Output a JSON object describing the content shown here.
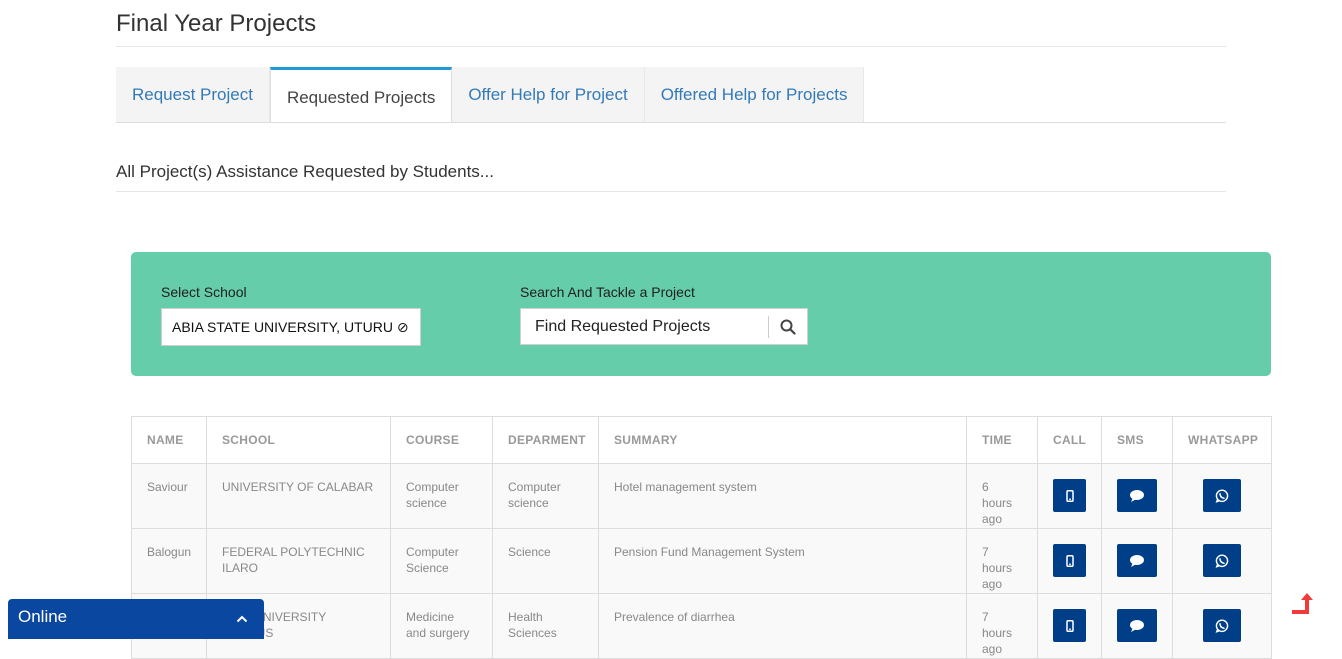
{
  "page": {
    "title": "Final Year Projects"
  },
  "tabs": [
    {
      "label": "Request Project",
      "active": false
    },
    {
      "label": "Requested Projects",
      "active": true
    },
    {
      "label": "Offer Help for Project",
      "active": false
    },
    {
      "label": "Offered Help for Projects",
      "active": false
    }
  ],
  "section": {
    "heading": "All Project(s) Assistance Requested by Students..."
  },
  "filters": {
    "school_label": "Select School",
    "school_value": "ABIA STATE UNIVERSITY, UTURU ⊘",
    "search_label": "Search And Tackle a Project",
    "search_value": "Find Requested Projects",
    "search_icon": "search-icon"
  },
  "table": {
    "headers": [
      "NAME",
      "SCHOOL",
      "COURSE",
      "DEPARMENT",
      "SUMMARY",
      "TIME",
      "CALL",
      "SMS",
      "WHATSAPP"
    ],
    "rows": [
      {
        "name": "Saviour",
        "school": "UNIVERSITY OF CALABAR",
        "course": "Computer science",
        "department": "Computer science",
        "summary": "Hotel management system",
        "time": "6 hours ago"
      },
      {
        "name": "Balogun",
        "school": "FEDERAL POLYTECHNIC ILARO",
        "course": "Computer Science",
        "department": "Science",
        "summary": "Pension Fund Management System",
        "time": "7 hours ago"
      },
      {
        "name": "",
        "school": "TATE UNIVERSITY CAMPUS",
        "course": "Medicine and surgery",
        "department": "Health Sciences",
        "summary": "Prevalence of diarrhea",
        "time": "7 hours ago"
      }
    ],
    "actions": {
      "call_icon": "mobile-phone-icon",
      "sms_icon": "chat-bubble-icon",
      "whatsapp_icon": "whatsapp-icon"
    }
  },
  "chat": {
    "label": "Online",
    "icon": "chevron-up-icon"
  },
  "colors": {
    "panel": "#66cdaa",
    "action_button": "#003f87",
    "chat_bar": "#0a47a1",
    "tab_accent": "#1f9ad6",
    "link": "#337ab7",
    "scroll_top_arrow": "#ef3b3b"
  }
}
